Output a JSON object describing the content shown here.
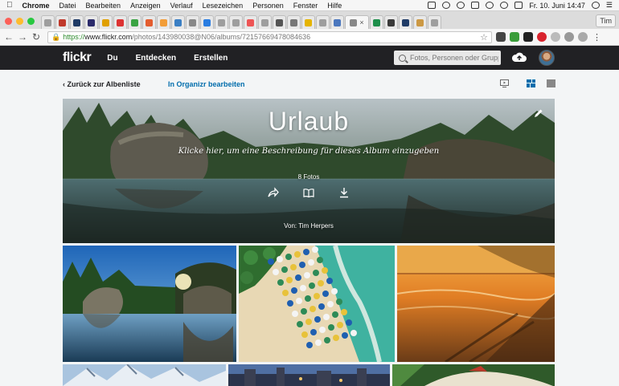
{
  "menubar": {
    "app": "Chrome",
    "items": [
      "Datei",
      "Bearbeiten",
      "Anzeigen",
      "Verlauf",
      "Lesezeichen",
      "Personen",
      "Fenster",
      "Hilfe"
    ],
    "clock": "Fr. 10. Juni  14:47"
  },
  "browser": {
    "profile": "Tim",
    "url_https": "https://",
    "url_host": "www.flickr.com",
    "url_path": "/photos/143980038@N06/albums/72157669478084636",
    "tab_colors": [
      "#9e9e9e",
      "#c0392b",
      "#1f3b66",
      "#2b2b6b",
      "#e0a000",
      "#d33",
      "#3aa343",
      "#e35d2f",
      "#f29d38",
      "#3b7fc4",
      "#888",
      "#2a7de1",
      "#9e9e9e",
      "#9e9e9e",
      "#e55",
      "#9e9e9e",
      "#555",
      "#777",
      "#e5b400",
      "#9e9e9e",
      "#4b77be",
      "#888",
      "#1e8f4b",
      "#3a3a3a",
      "#1f3b66",
      "#c94",
      "#9e9e9e"
    ],
    "ext_colors": [
      "#444",
      "#3a9d3a",
      "#222",
      "#d9232d",
      "#bbb",
      "#999",
      "#aaa"
    ]
  },
  "flickr": {
    "logo": "flickr",
    "nav": [
      "Du",
      "Entdecken",
      "Erstellen"
    ],
    "search_placeholder": "Fotos, Personen oder Gruppen"
  },
  "album_bar": {
    "back_label": "Zurück zur Albenliste",
    "organizr_label": "In Organizr bearbeiten"
  },
  "album": {
    "title": "Urlaub",
    "description_prompt": "Klicke hier, um eine Beschreibung für dieses Album einzugeben",
    "photo_count": "8 Fotos",
    "owner": "Von: Tim Herpers"
  },
  "colors": {
    "accent": "#006dac",
    "header_bg": "#212124",
    "page_bg": "#f3f5f6"
  }
}
